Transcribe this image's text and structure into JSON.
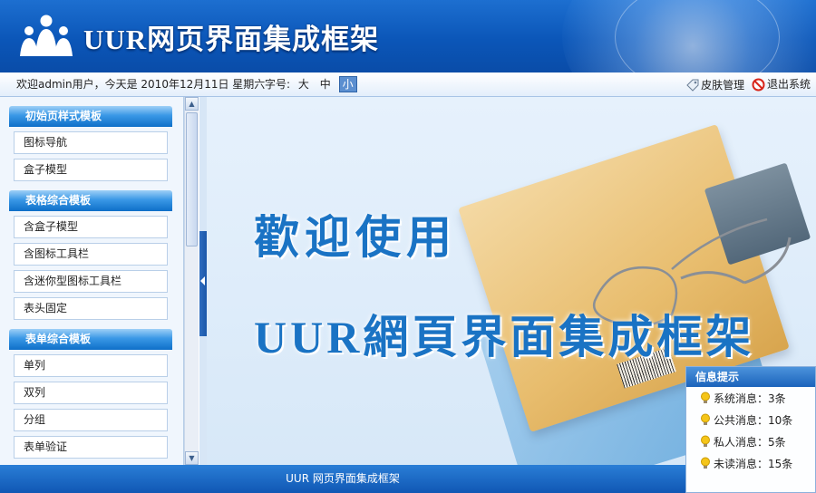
{
  "header": {
    "app_title": "UUR网页界面集成框架"
  },
  "toolbar": {
    "welcome": "欢迎admin用户，今天是 2010年12月11日 星期六",
    "font_size_label": "字号:",
    "font_sizes": [
      "大",
      "中",
      "小"
    ],
    "font_size_selected": "小",
    "skin_label": "皮肤管理",
    "logout_label": "退出系统"
  },
  "sidebar": {
    "groups": [
      {
        "title": "初始页样式模板",
        "items": [
          "图标导航",
          "盒子模型"
        ]
      },
      {
        "title": "表格综合模板",
        "items": [
          "含盒子模型",
          "含图标工具栏",
          "含迷你型图标工具栏",
          "表头固定"
        ]
      },
      {
        "title": "表单综合模板",
        "items": [
          "单列",
          "双列",
          "分组",
          "表单验证"
        ]
      }
    ]
  },
  "main": {
    "welcome_line1": "歡迎使用",
    "welcome_line2": "UUR網頁界面集成框架"
  },
  "info_panel": {
    "title": "信息提示",
    "items": [
      "系统消息：3条",
      "公共消息：10条",
      "私人消息：5条",
      "未读消息：15条"
    ]
  },
  "footer": {
    "text": "UUR 网页界面集成框架"
  },
  "colors": {
    "header_blue": "#0b56b8",
    "accent_blue": "#1a73c4",
    "sidebar_bg": "#f0f6fd"
  },
  "icons": {
    "skin": "tag-icon",
    "logout": "forbidden-icon",
    "info": "lightbulb-icon",
    "logo": "people-logo-icon"
  }
}
